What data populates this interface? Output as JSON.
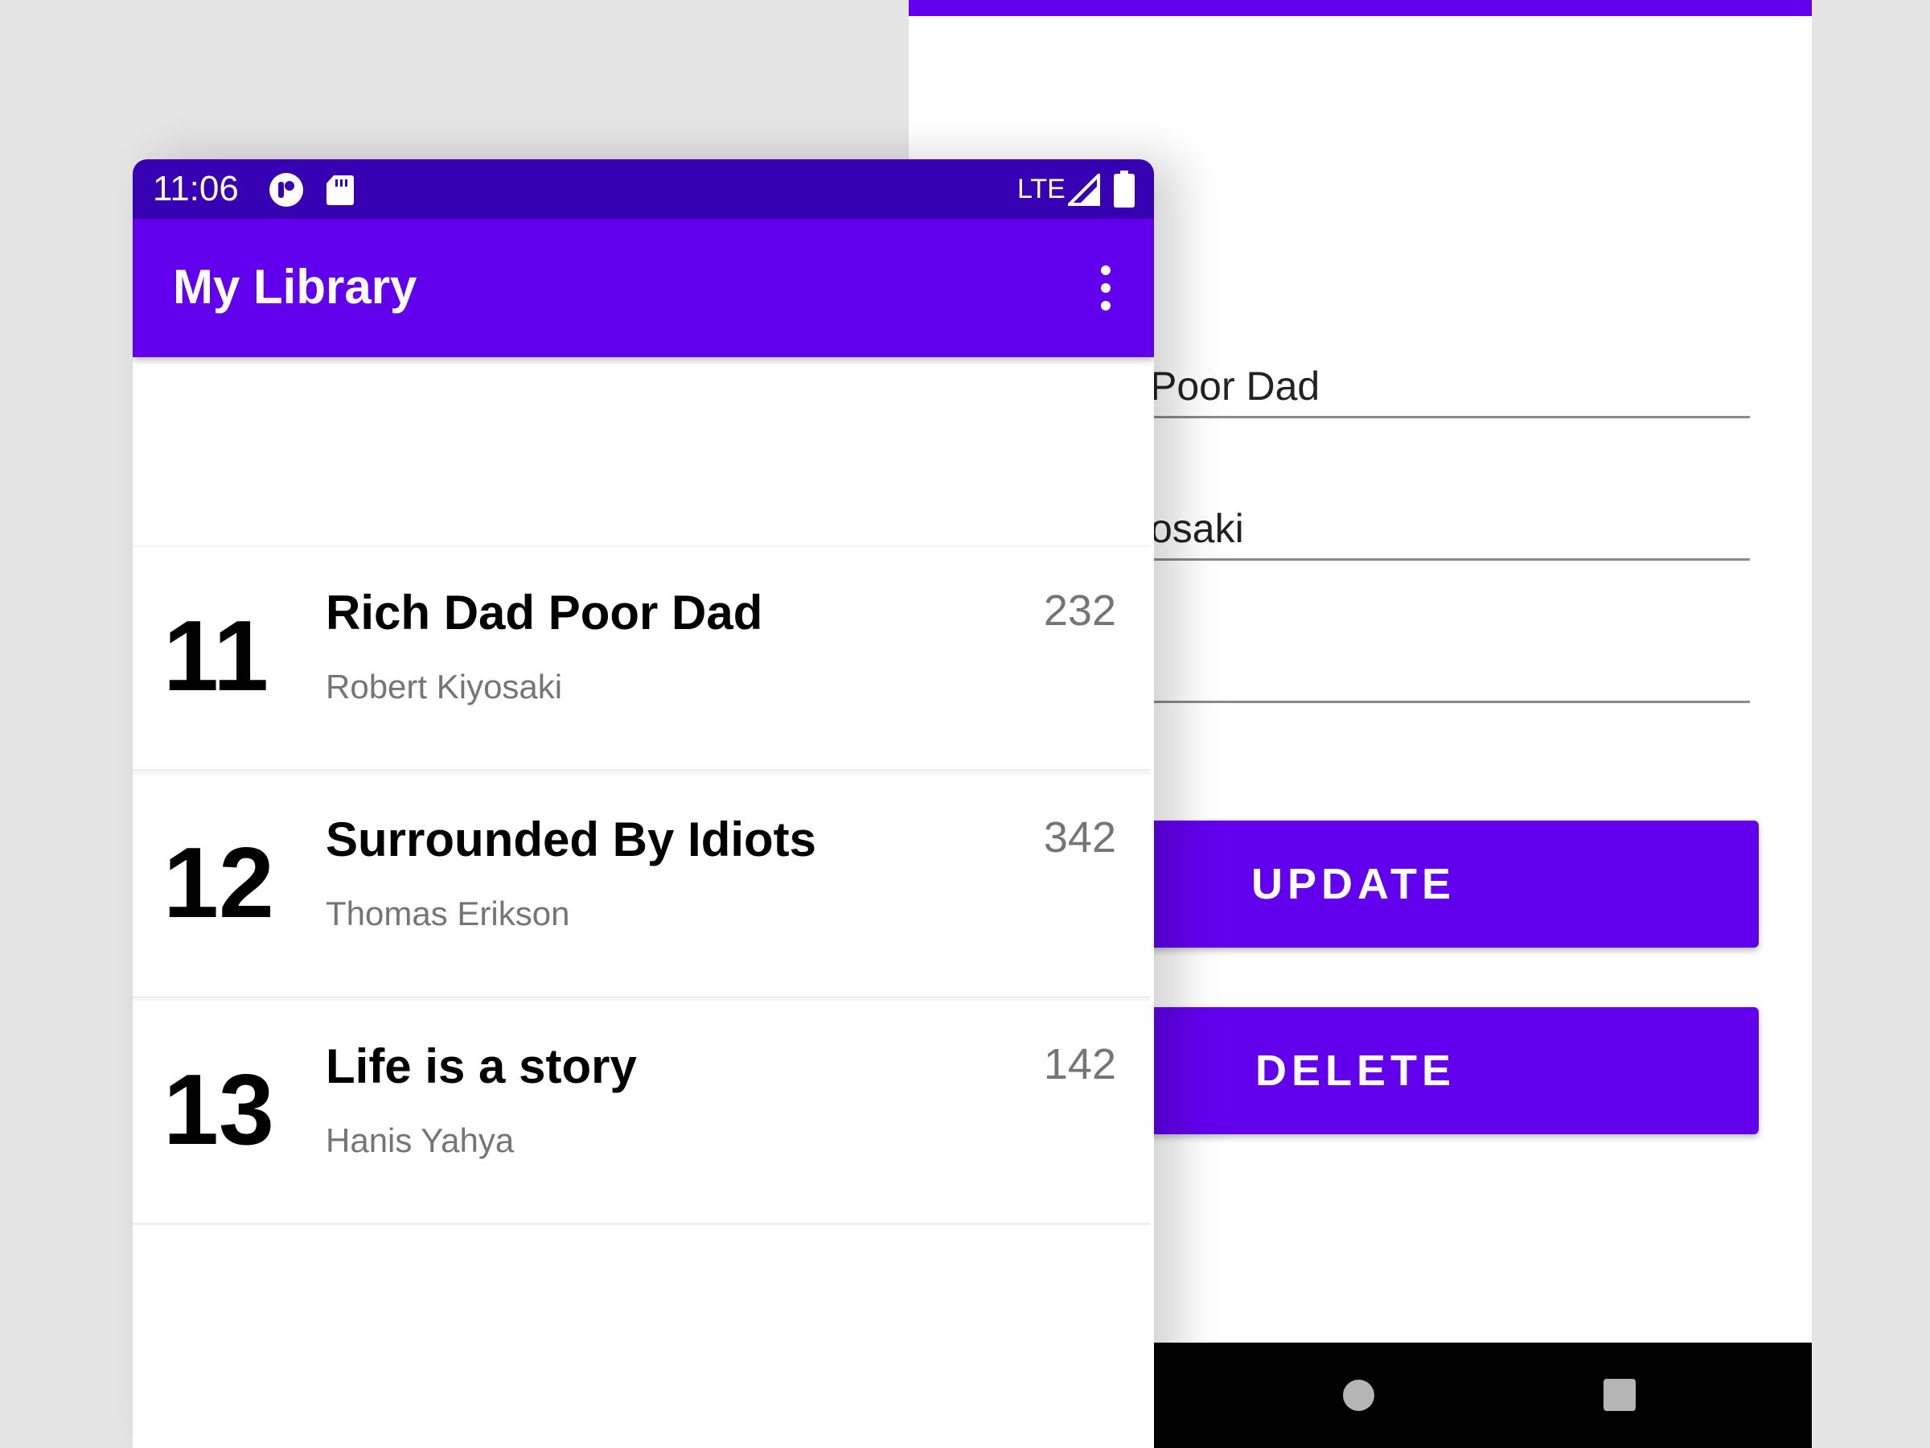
{
  "colors": {
    "primary": "#6200ee",
    "primary_dark": "#3700b3",
    "background": "#e5e5e5",
    "secondary_text": "#757575"
  },
  "back_screen": {
    "fields": [
      {
        "visible_text": "Poor Dad"
      },
      {
        "visible_text": "osaki"
      },
      {
        "visible_text": ""
      }
    ],
    "buttons": {
      "update_label": "UPDATE",
      "delete_label": "DELETE"
    },
    "nav_icons": [
      "home-circle-icon",
      "recents-square-icon"
    ]
  },
  "status_bar": {
    "time": "11:06",
    "network": "LTE",
    "icons": [
      "notification-app-icon",
      "sd-card-icon",
      "signal-icon",
      "battery-icon"
    ]
  },
  "app_bar": {
    "title": "My Library",
    "menu_icon": "overflow-menu-icon"
  },
  "books": [
    {
      "id": "11",
      "title": "Rich Dad Poor Dad",
      "author": "Robert Kiyosaki",
      "pages": "232"
    },
    {
      "id": "12",
      "title": "Surrounded By Idiots",
      "author": "Thomas Erikson",
      "pages": "342"
    },
    {
      "id": "13",
      "title": "Life is a story",
      "author": "Hanis Yahya",
      "pages": "142"
    }
  ]
}
